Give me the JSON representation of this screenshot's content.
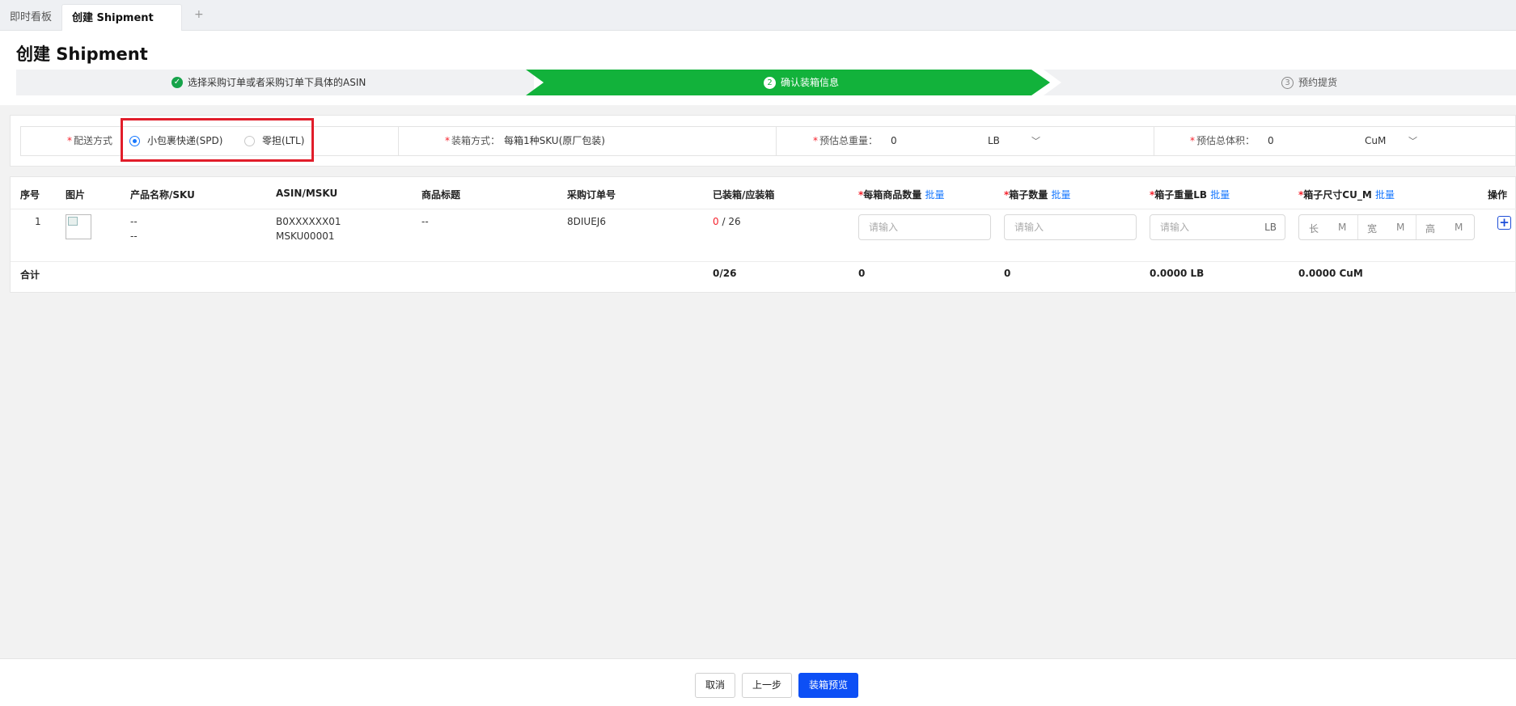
{
  "tabs": [
    {
      "label": "即时看板"
    },
    {
      "label": "创建 Shipment"
    }
  ],
  "tab_add": "+",
  "page_title": "创建 Shipment",
  "steps": [
    {
      "label": "选择采购订单或者采购订单下具体的ASIN",
      "status": "done"
    },
    {
      "number": "2",
      "label": "确认装箱信息",
      "status": "active"
    },
    {
      "number": "3",
      "label": "预约提货",
      "status": "pending"
    }
  ],
  "form": {
    "shipping": {
      "required": "*",
      "label": "配送方式",
      "options": [
        "小包裹快递(SPD)",
        "零担(LTL)"
      ],
      "selected": "小包裹快递(SPD)"
    },
    "packing": {
      "required": "*",
      "label": "装箱方式：",
      "value": "每箱1种SKU(原厂包装)"
    },
    "weight": {
      "required": "*",
      "label": "预估总重量：",
      "value": "0",
      "unit": "LB"
    },
    "volume": {
      "required": "*",
      "label": "预估总体积：",
      "value": "0",
      "unit": "CuM"
    }
  },
  "table": {
    "headers": {
      "index": "序号",
      "image": "图片",
      "product": "产品名称/SKU",
      "asin": "ASIN/MSKU",
      "title": "商品标题",
      "po": "采购订单号",
      "boxed": "已装箱/应装箱",
      "per_box": "每箱商品数量",
      "box_count": "箱子数量",
      "box_weight": "箱子重量LB",
      "box_size": "箱子尺寸CU_M",
      "action": "操作",
      "required": "*",
      "bulk": "批量"
    },
    "rows": [
      {
        "index": "1",
        "product_name": "--",
        "sku": "--",
        "asin": "B0XXXXXX01",
        "msku": "MSKU00001",
        "title": "--",
        "po": "8DIUEJ6",
        "boxed": "0",
        "boxed_sep": " / ",
        "to_box": "26",
        "placeholder": "请输入",
        "weight_unit": "LB",
        "dims": [
          {
            "label": "长",
            "unit": "M"
          },
          {
            "label": "宽",
            "unit": "M"
          },
          {
            "label": "高",
            "unit": "M"
          }
        ]
      }
    ],
    "totals": {
      "label": "合计",
      "boxed": "0/26",
      "per_box": "0",
      "box_count": "0",
      "box_weight": "0.0000 LB",
      "box_size": "0.0000 CuM"
    }
  },
  "footer": {
    "cancel": "取消",
    "prev": "上一步",
    "preview": "装箱预览"
  },
  "colors": {
    "accent": "#0d4ff5",
    "step_active": "#12b23b",
    "required": "#f5222d",
    "highlight_box": "#e11d2a"
  }
}
